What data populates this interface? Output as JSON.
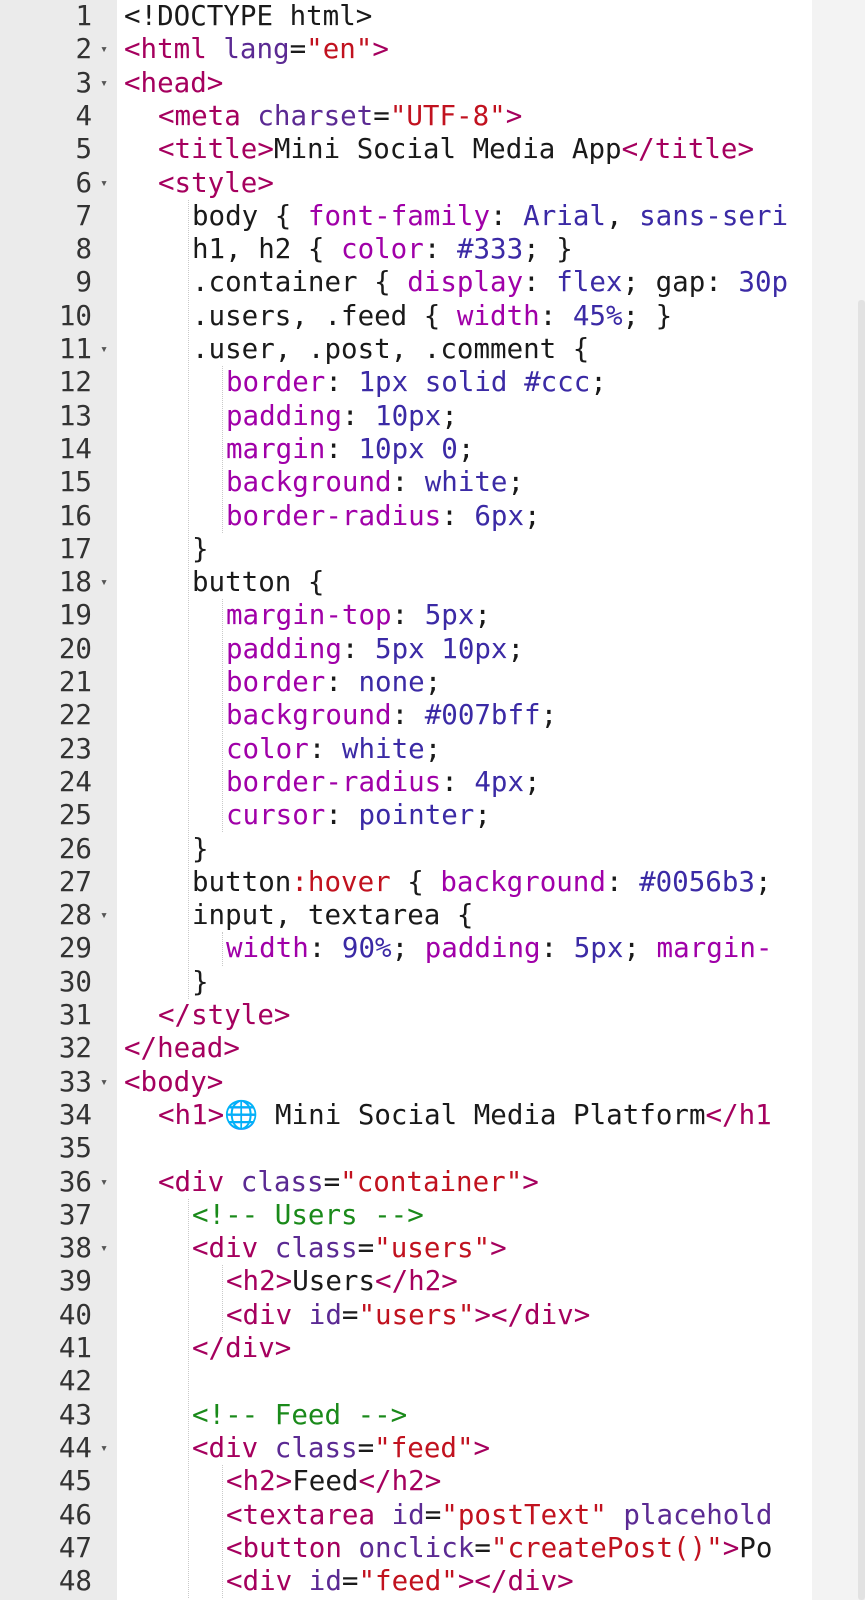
{
  "editor": {
    "lines": [
      {
        "n": "1",
        "fold": false,
        "indent": 0,
        "tokens": [
          {
            "t": "plain",
            "v": "<!DOCTYPE html>"
          }
        ]
      },
      {
        "n": "2",
        "fold": true,
        "indent": 0,
        "tokens": [
          {
            "t": "tag",
            "v": "<html "
          },
          {
            "t": "attr",
            "v": "lang"
          },
          {
            "t": "plain",
            "v": "="
          },
          {
            "t": "str",
            "v": "\"en\""
          },
          {
            "t": "tag",
            "v": ">"
          }
        ]
      },
      {
        "n": "3",
        "fold": true,
        "indent": 0,
        "tokens": [
          {
            "t": "tag",
            "v": "<head>"
          }
        ]
      },
      {
        "n": "4",
        "fold": false,
        "indent": 1,
        "tokens": [
          {
            "t": "tag",
            "v": "<meta "
          },
          {
            "t": "attr",
            "v": "charset"
          },
          {
            "t": "plain",
            "v": "="
          },
          {
            "t": "str",
            "v": "\"UTF-8\""
          },
          {
            "t": "tag",
            "v": ">"
          }
        ]
      },
      {
        "n": "5",
        "fold": false,
        "indent": 1,
        "tokens": [
          {
            "t": "tag",
            "v": "<title>"
          },
          {
            "t": "plain",
            "v": "Mini Social Media App"
          },
          {
            "t": "tag",
            "v": "</title>"
          }
        ]
      },
      {
        "n": "6",
        "fold": true,
        "indent": 1,
        "tokens": [
          {
            "t": "tag",
            "v": "<style>"
          }
        ]
      },
      {
        "n": "7",
        "fold": false,
        "indent": 2,
        "tokens": [
          {
            "t": "plain",
            "v": "body { "
          },
          {
            "t": "prop",
            "v": "font-family"
          },
          {
            "t": "plain",
            "v": ": "
          },
          {
            "t": "val",
            "v": "Arial"
          },
          {
            "t": "plain",
            "v": ", "
          },
          {
            "t": "val",
            "v": "sans-seri"
          }
        ]
      },
      {
        "n": "8",
        "fold": false,
        "indent": 2,
        "tokens": [
          {
            "t": "plain",
            "v": "h1, h2 { "
          },
          {
            "t": "prop",
            "v": "color"
          },
          {
            "t": "plain",
            "v": ": "
          },
          {
            "t": "val",
            "v": "#333"
          },
          {
            "t": "plain",
            "v": "; }"
          }
        ]
      },
      {
        "n": "9",
        "fold": false,
        "indent": 2,
        "tokens": [
          {
            "t": "plain",
            "v": ".container { "
          },
          {
            "t": "prop",
            "v": "display"
          },
          {
            "t": "plain",
            "v": ": "
          },
          {
            "t": "val",
            "v": "flex"
          },
          {
            "t": "plain",
            "v": "; gap: "
          },
          {
            "t": "num",
            "v": "30p"
          }
        ]
      },
      {
        "n": "10",
        "fold": false,
        "indent": 2,
        "tokens": [
          {
            "t": "plain",
            "v": ".users, .feed { "
          },
          {
            "t": "prop",
            "v": "width"
          },
          {
            "t": "plain",
            "v": ": "
          },
          {
            "t": "num",
            "v": "45%"
          },
          {
            "t": "plain",
            "v": "; }"
          }
        ]
      },
      {
        "n": "11",
        "fold": true,
        "indent": 2,
        "tokens": [
          {
            "t": "plain",
            "v": ".user, .post, .comment {"
          }
        ]
      },
      {
        "n": "12",
        "fold": false,
        "indent": 3,
        "tokens": [
          {
            "t": "prop",
            "v": "border"
          },
          {
            "t": "plain",
            "v": ": "
          },
          {
            "t": "num",
            "v": "1px"
          },
          {
            "t": "plain",
            "v": " "
          },
          {
            "t": "val",
            "v": "solid"
          },
          {
            "t": "plain",
            "v": " "
          },
          {
            "t": "val",
            "v": "#ccc"
          },
          {
            "t": "plain",
            "v": ";"
          }
        ]
      },
      {
        "n": "13",
        "fold": false,
        "indent": 3,
        "tokens": [
          {
            "t": "prop",
            "v": "padding"
          },
          {
            "t": "plain",
            "v": ": "
          },
          {
            "t": "num",
            "v": "10px"
          },
          {
            "t": "plain",
            "v": ";"
          }
        ]
      },
      {
        "n": "14",
        "fold": false,
        "indent": 3,
        "tokens": [
          {
            "t": "prop",
            "v": "margin"
          },
          {
            "t": "plain",
            "v": ": "
          },
          {
            "t": "num",
            "v": "10px"
          },
          {
            "t": "plain",
            "v": " "
          },
          {
            "t": "num",
            "v": "0"
          },
          {
            "t": "plain",
            "v": ";"
          }
        ]
      },
      {
        "n": "15",
        "fold": false,
        "indent": 3,
        "tokens": [
          {
            "t": "prop",
            "v": "background"
          },
          {
            "t": "plain",
            "v": ": "
          },
          {
            "t": "val",
            "v": "white"
          },
          {
            "t": "plain",
            "v": ";"
          }
        ]
      },
      {
        "n": "16",
        "fold": false,
        "indent": 3,
        "tokens": [
          {
            "t": "prop",
            "v": "border-radius"
          },
          {
            "t": "plain",
            "v": ": "
          },
          {
            "t": "num",
            "v": "6px"
          },
          {
            "t": "plain",
            "v": ";"
          }
        ]
      },
      {
        "n": "17",
        "fold": false,
        "indent": 2,
        "tokens": [
          {
            "t": "plain",
            "v": "}"
          }
        ]
      },
      {
        "n": "18",
        "fold": true,
        "indent": 2,
        "tokens": [
          {
            "t": "plain",
            "v": "button {"
          }
        ]
      },
      {
        "n": "19",
        "fold": false,
        "indent": 3,
        "tokens": [
          {
            "t": "prop",
            "v": "margin-top"
          },
          {
            "t": "plain",
            "v": ": "
          },
          {
            "t": "num",
            "v": "5px"
          },
          {
            "t": "plain",
            "v": ";"
          }
        ]
      },
      {
        "n": "20",
        "fold": false,
        "indent": 3,
        "tokens": [
          {
            "t": "prop",
            "v": "padding"
          },
          {
            "t": "plain",
            "v": ": "
          },
          {
            "t": "num",
            "v": "5px"
          },
          {
            "t": "plain",
            "v": " "
          },
          {
            "t": "num",
            "v": "10px"
          },
          {
            "t": "plain",
            "v": ";"
          }
        ]
      },
      {
        "n": "21",
        "fold": false,
        "indent": 3,
        "tokens": [
          {
            "t": "prop",
            "v": "border"
          },
          {
            "t": "plain",
            "v": ": "
          },
          {
            "t": "val",
            "v": "none"
          },
          {
            "t": "plain",
            "v": ";"
          }
        ]
      },
      {
        "n": "22",
        "fold": false,
        "indent": 3,
        "tokens": [
          {
            "t": "prop",
            "v": "background"
          },
          {
            "t": "plain",
            "v": ": "
          },
          {
            "t": "val",
            "v": "#007bff"
          },
          {
            "t": "plain",
            "v": ";"
          }
        ]
      },
      {
        "n": "23",
        "fold": false,
        "indent": 3,
        "tokens": [
          {
            "t": "prop",
            "v": "color"
          },
          {
            "t": "plain",
            "v": ": "
          },
          {
            "t": "val",
            "v": "white"
          },
          {
            "t": "plain",
            "v": ";"
          }
        ]
      },
      {
        "n": "24",
        "fold": false,
        "indent": 3,
        "tokens": [
          {
            "t": "prop",
            "v": "border-radius"
          },
          {
            "t": "plain",
            "v": ": "
          },
          {
            "t": "num",
            "v": "4px"
          },
          {
            "t": "plain",
            "v": ";"
          }
        ]
      },
      {
        "n": "25",
        "fold": false,
        "indent": 3,
        "tokens": [
          {
            "t": "prop",
            "v": "cursor"
          },
          {
            "t": "plain",
            "v": ": "
          },
          {
            "t": "val",
            "v": "pointer"
          },
          {
            "t": "plain",
            "v": ";"
          }
        ]
      },
      {
        "n": "26",
        "fold": false,
        "indent": 2,
        "tokens": [
          {
            "t": "plain",
            "v": "}"
          }
        ]
      },
      {
        "n": "27",
        "fold": false,
        "indent": 2,
        "tokens": [
          {
            "t": "plain",
            "v": "button"
          },
          {
            "t": "pseudo",
            "v": ":hover"
          },
          {
            "t": "plain",
            "v": " { "
          },
          {
            "t": "prop",
            "v": "background"
          },
          {
            "t": "plain",
            "v": ": "
          },
          {
            "t": "val",
            "v": "#0056b3"
          },
          {
            "t": "plain",
            "v": ";"
          }
        ]
      },
      {
        "n": "28",
        "fold": true,
        "indent": 2,
        "tokens": [
          {
            "t": "plain",
            "v": "input, textarea {"
          }
        ]
      },
      {
        "n": "29",
        "fold": false,
        "indent": 3,
        "tokens": [
          {
            "t": "prop",
            "v": "width"
          },
          {
            "t": "plain",
            "v": ": "
          },
          {
            "t": "num",
            "v": "90%"
          },
          {
            "t": "plain",
            "v": "; "
          },
          {
            "t": "prop",
            "v": "padding"
          },
          {
            "t": "plain",
            "v": ": "
          },
          {
            "t": "num",
            "v": "5px"
          },
          {
            "t": "plain",
            "v": "; "
          },
          {
            "t": "prop",
            "v": "margin-"
          }
        ]
      },
      {
        "n": "30",
        "fold": false,
        "indent": 2,
        "tokens": [
          {
            "t": "plain",
            "v": "}"
          }
        ]
      },
      {
        "n": "31",
        "fold": false,
        "indent": 1,
        "tokens": [
          {
            "t": "tag",
            "v": "</style>"
          }
        ]
      },
      {
        "n": "32",
        "fold": false,
        "indent": 0,
        "tokens": [
          {
            "t": "tag",
            "v": "</head>"
          }
        ]
      },
      {
        "n": "33",
        "fold": true,
        "indent": 0,
        "tokens": [
          {
            "t": "tag",
            "v": "<body>"
          }
        ]
      },
      {
        "n": "34",
        "fold": false,
        "indent": 1,
        "tokens": [
          {
            "t": "tag",
            "v": "<h1>"
          },
          {
            "t": "plain",
            "v": "🌐 Mini Social Media Platform"
          },
          {
            "t": "tag",
            "v": "</h1"
          }
        ]
      },
      {
        "n": "35",
        "fold": false,
        "indent": 0,
        "tokens": []
      },
      {
        "n": "36",
        "fold": true,
        "indent": 1,
        "tokens": [
          {
            "t": "tag",
            "v": "<div "
          },
          {
            "t": "attr",
            "v": "class"
          },
          {
            "t": "plain",
            "v": "="
          },
          {
            "t": "str",
            "v": "\"container\""
          },
          {
            "t": "tag",
            "v": ">"
          }
        ]
      },
      {
        "n": "37",
        "fold": false,
        "indent": 2,
        "tokens": [
          {
            "t": "cmt",
            "v": "<!-- Users -->"
          }
        ]
      },
      {
        "n": "38",
        "fold": true,
        "indent": 2,
        "tokens": [
          {
            "t": "tag",
            "v": "<div "
          },
          {
            "t": "attr",
            "v": "class"
          },
          {
            "t": "plain",
            "v": "="
          },
          {
            "t": "str",
            "v": "\"users\""
          },
          {
            "t": "tag",
            "v": ">"
          }
        ]
      },
      {
        "n": "39",
        "fold": false,
        "indent": 3,
        "tokens": [
          {
            "t": "tag",
            "v": "<h2>"
          },
          {
            "t": "plain",
            "v": "Users"
          },
          {
            "t": "tag",
            "v": "</h2>"
          }
        ]
      },
      {
        "n": "40",
        "fold": false,
        "indent": 3,
        "tokens": [
          {
            "t": "tag",
            "v": "<div "
          },
          {
            "t": "attr",
            "v": "id"
          },
          {
            "t": "plain",
            "v": "="
          },
          {
            "t": "str",
            "v": "\"users\""
          },
          {
            "t": "tag",
            "v": "></div>"
          }
        ]
      },
      {
        "n": "41",
        "fold": false,
        "indent": 2,
        "tokens": [
          {
            "t": "tag",
            "v": "</div>"
          }
        ]
      },
      {
        "n": "42",
        "fold": false,
        "indent": 0,
        "tokens": []
      },
      {
        "n": "43",
        "fold": false,
        "indent": 2,
        "tokens": [
          {
            "t": "cmt",
            "v": "<!-- Feed -->"
          }
        ]
      },
      {
        "n": "44",
        "fold": true,
        "indent": 2,
        "tokens": [
          {
            "t": "tag",
            "v": "<div "
          },
          {
            "t": "attr",
            "v": "class"
          },
          {
            "t": "plain",
            "v": "="
          },
          {
            "t": "str",
            "v": "\"feed\""
          },
          {
            "t": "tag",
            "v": ">"
          }
        ]
      },
      {
        "n": "45",
        "fold": false,
        "indent": 3,
        "tokens": [
          {
            "t": "tag",
            "v": "<h2>"
          },
          {
            "t": "plain",
            "v": "Feed"
          },
          {
            "t": "tag",
            "v": "</h2>"
          }
        ]
      },
      {
        "n": "46",
        "fold": false,
        "indent": 3,
        "tokens": [
          {
            "t": "tag",
            "v": "<textarea "
          },
          {
            "t": "attr",
            "v": "id"
          },
          {
            "t": "plain",
            "v": "="
          },
          {
            "t": "str",
            "v": "\"postText\""
          },
          {
            "t": "plain",
            "v": " "
          },
          {
            "t": "attr",
            "v": "placehold"
          }
        ]
      },
      {
        "n": "47",
        "fold": false,
        "indent": 3,
        "tokens": [
          {
            "t": "tag",
            "v": "<button "
          },
          {
            "t": "attr",
            "v": "onclick"
          },
          {
            "t": "plain",
            "v": "="
          },
          {
            "t": "str",
            "v": "\"createPost()\""
          },
          {
            "t": "tag",
            "v": ">"
          },
          {
            "t": "plain",
            "v": "Po"
          }
        ]
      },
      {
        "n": "48",
        "fold": false,
        "indent": 3,
        "tokens": [
          {
            "t": "tag",
            "v": "<div "
          },
          {
            "t": "attr",
            "v": "id"
          },
          {
            "t": "plain",
            "v": "="
          },
          {
            "t": "str",
            "v": "\"feed\""
          },
          {
            "t": "tag",
            "v": "></div>"
          }
        ]
      }
    ],
    "fold_icon": "triangle-down-icon"
  }
}
